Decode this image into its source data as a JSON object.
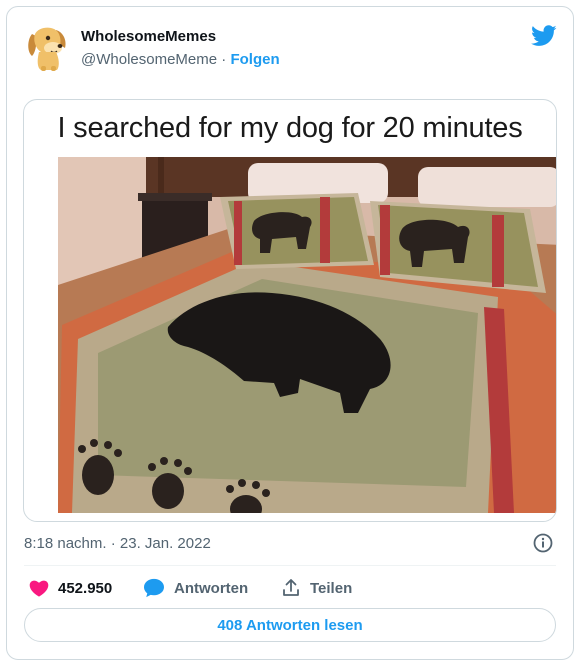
{
  "author": {
    "display_name": "WholesomeMemes",
    "handle": "@WholesomeMeme",
    "separator": " · ",
    "follow_label": "Folgen",
    "avatar_icon": "cartoon-dog-avatar"
  },
  "brand": {
    "icon": "twitter-bird-icon",
    "color": "#1d9bf0"
  },
  "media": {
    "caption": "I searched for my dog for 20 minutes",
    "description_icon": "black-dog-on-bear-quilt-photo"
  },
  "meta": {
    "timestamp": "8:18 nachm. · 23. Jan. 2022",
    "info_icon": "info-icon"
  },
  "actions": {
    "likes_count": "452.950",
    "like_color": "#f91880",
    "reply_label": "Antworten",
    "share_label": "Teilen"
  },
  "footer": {
    "read_replies_label": "408 Antworten lesen"
  },
  "colors": {
    "link": "#1d9bf0",
    "secondary_text": "#536471",
    "border": "#cfd9de"
  }
}
